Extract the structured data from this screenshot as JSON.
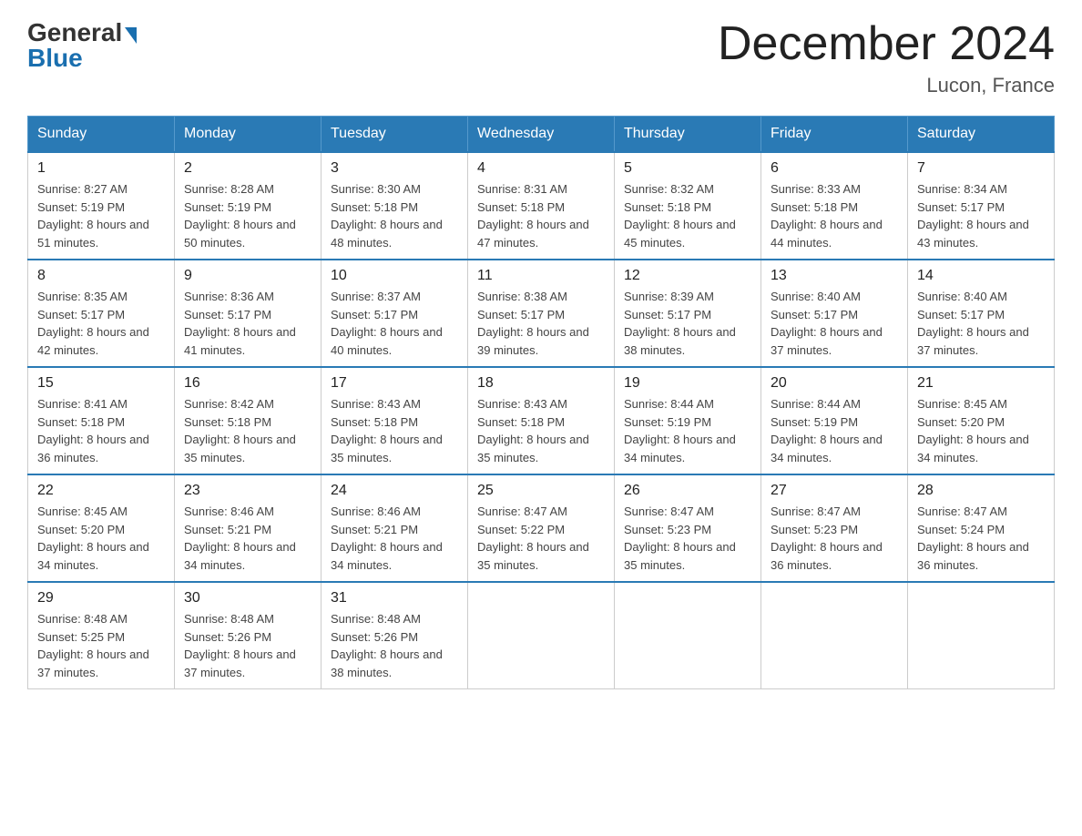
{
  "header": {
    "logo_general": "General",
    "logo_blue": "Blue",
    "title": "December 2024",
    "subtitle": "Lucon, France"
  },
  "weekdays": [
    "Sunday",
    "Monday",
    "Tuesday",
    "Wednesday",
    "Thursday",
    "Friday",
    "Saturday"
  ],
  "weeks": [
    [
      {
        "day": "1",
        "sunrise": "8:27 AM",
        "sunset": "5:19 PM",
        "daylight": "8 hours and 51 minutes."
      },
      {
        "day": "2",
        "sunrise": "8:28 AM",
        "sunset": "5:19 PM",
        "daylight": "8 hours and 50 minutes."
      },
      {
        "day": "3",
        "sunrise": "8:30 AM",
        "sunset": "5:18 PM",
        "daylight": "8 hours and 48 minutes."
      },
      {
        "day": "4",
        "sunrise": "8:31 AM",
        "sunset": "5:18 PM",
        "daylight": "8 hours and 47 minutes."
      },
      {
        "day": "5",
        "sunrise": "8:32 AM",
        "sunset": "5:18 PM",
        "daylight": "8 hours and 45 minutes."
      },
      {
        "day": "6",
        "sunrise": "8:33 AM",
        "sunset": "5:18 PM",
        "daylight": "8 hours and 44 minutes."
      },
      {
        "day": "7",
        "sunrise": "8:34 AM",
        "sunset": "5:17 PM",
        "daylight": "8 hours and 43 minutes."
      }
    ],
    [
      {
        "day": "8",
        "sunrise": "8:35 AM",
        "sunset": "5:17 PM",
        "daylight": "8 hours and 42 minutes."
      },
      {
        "day": "9",
        "sunrise": "8:36 AM",
        "sunset": "5:17 PM",
        "daylight": "8 hours and 41 minutes."
      },
      {
        "day": "10",
        "sunrise": "8:37 AM",
        "sunset": "5:17 PM",
        "daylight": "8 hours and 40 minutes."
      },
      {
        "day": "11",
        "sunrise": "8:38 AM",
        "sunset": "5:17 PM",
        "daylight": "8 hours and 39 minutes."
      },
      {
        "day": "12",
        "sunrise": "8:39 AM",
        "sunset": "5:17 PM",
        "daylight": "8 hours and 38 minutes."
      },
      {
        "day": "13",
        "sunrise": "8:40 AM",
        "sunset": "5:17 PM",
        "daylight": "8 hours and 37 minutes."
      },
      {
        "day": "14",
        "sunrise": "8:40 AM",
        "sunset": "5:17 PM",
        "daylight": "8 hours and 37 minutes."
      }
    ],
    [
      {
        "day": "15",
        "sunrise": "8:41 AM",
        "sunset": "5:18 PM",
        "daylight": "8 hours and 36 minutes."
      },
      {
        "day": "16",
        "sunrise": "8:42 AM",
        "sunset": "5:18 PM",
        "daylight": "8 hours and 35 minutes."
      },
      {
        "day": "17",
        "sunrise": "8:43 AM",
        "sunset": "5:18 PM",
        "daylight": "8 hours and 35 minutes."
      },
      {
        "day": "18",
        "sunrise": "8:43 AM",
        "sunset": "5:18 PM",
        "daylight": "8 hours and 35 minutes."
      },
      {
        "day": "19",
        "sunrise": "8:44 AM",
        "sunset": "5:19 PM",
        "daylight": "8 hours and 34 minutes."
      },
      {
        "day": "20",
        "sunrise": "8:44 AM",
        "sunset": "5:19 PM",
        "daylight": "8 hours and 34 minutes."
      },
      {
        "day": "21",
        "sunrise": "8:45 AM",
        "sunset": "5:20 PM",
        "daylight": "8 hours and 34 minutes."
      }
    ],
    [
      {
        "day": "22",
        "sunrise": "8:45 AM",
        "sunset": "5:20 PM",
        "daylight": "8 hours and 34 minutes."
      },
      {
        "day": "23",
        "sunrise": "8:46 AM",
        "sunset": "5:21 PM",
        "daylight": "8 hours and 34 minutes."
      },
      {
        "day": "24",
        "sunrise": "8:46 AM",
        "sunset": "5:21 PM",
        "daylight": "8 hours and 34 minutes."
      },
      {
        "day": "25",
        "sunrise": "8:47 AM",
        "sunset": "5:22 PM",
        "daylight": "8 hours and 35 minutes."
      },
      {
        "day": "26",
        "sunrise": "8:47 AM",
        "sunset": "5:23 PM",
        "daylight": "8 hours and 35 minutes."
      },
      {
        "day": "27",
        "sunrise": "8:47 AM",
        "sunset": "5:23 PM",
        "daylight": "8 hours and 36 minutes."
      },
      {
        "day": "28",
        "sunrise": "8:47 AM",
        "sunset": "5:24 PM",
        "daylight": "8 hours and 36 minutes."
      }
    ],
    [
      {
        "day": "29",
        "sunrise": "8:48 AM",
        "sunset": "5:25 PM",
        "daylight": "8 hours and 37 minutes."
      },
      {
        "day": "30",
        "sunrise": "8:48 AM",
        "sunset": "5:26 PM",
        "daylight": "8 hours and 37 minutes."
      },
      {
        "day": "31",
        "sunrise": "8:48 AM",
        "sunset": "5:26 PM",
        "daylight": "8 hours and 38 minutes."
      },
      null,
      null,
      null,
      null
    ]
  ]
}
